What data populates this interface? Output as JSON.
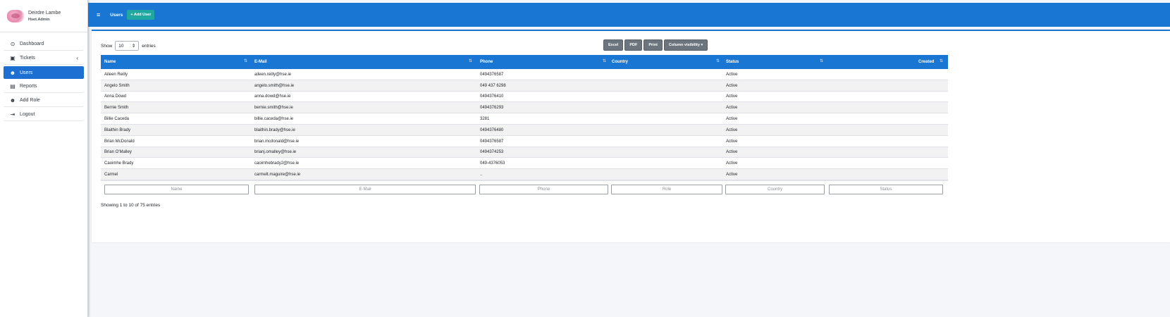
{
  "user": {
    "name": "Deirdre Lambe",
    "role": "Hset.Admin"
  },
  "sidebar": {
    "items": [
      {
        "label": "Dashboard",
        "icon": "dashboard-icon",
        "glyph": "⊙"
      },
      {
        "label": "Tickets",
        "icon": "ticket-icon",
        "glyph": "▣"
      },
      {
        "label": "Users",
        "icon": "users-icon",
        "glyph": "☻"
      },
      {
        "label": "Reports",
        "icon": "report-icon",
        "glyph": "▤"
      },
      {
        "label": "Add Role",
        "icon": "users-icon",
        "glyph": "☻"
      },
      {
        "label": "Logout",
        "icon": "logout-icon",
        "glyph": "⇥"
      }
    ],
    "caret": "‹"
  },
  "topbar": {
    "menu_glyph": "≡",
    "title": "Users",
    "add_user": "+ Add User"
  },
  "table_controls": {
    "show_label": "Show",
    "page_length": "10",
    "entries_label": "entries",
    "buttons": [
      "Excel",
      "PDF",
      "Print",
      "Column visibility ▾"
    ]
  },
  "table": {
    "columns": [
      "Name",
      "E-Mail",
      "Phone",
      "Country",
      "Status",
      "Created"
    ],
    "rows": [
      [
        "Aileen Reilly",
        "aileen.reilly@hse.ie",
        "0494376587",
        "",
        "Active",
        ""
      ],
      [
        "Angelo Smith",
        "angelo.smith@hse.ie",
        "049 437 6298",
        "",
        "Active",
        ""
      ],
      [
        "Anna Dowd",
        "anna.dowd@hse.ie",
        "0494376410",
        "",
        "Active",
        ""
      ],
      [
        "Bernie Smith",
        "bernie.smith@hse.ie",
        "0494376293",
        "",
        "Active",
        ""
      ],
      [
        "Billie Caceda",
        "billie.caceda@hse.ie",
        "3281",
        "",
        "Active",
        ""
      ],
      [
        "Blaithin Brady",
        "blaithin.brady@hse.ie",
        "0494376480",
        "",
        "Active",
        ""
      ],
      [
        "Brian McDonald",
        "brian.mcdonald@hse.ie",
        "0494376587",
        "",
        "Active",
        ""
      ],
      [
        "Brian O'Malley",
        "brianj.omalley@hse.ie",
        "0494374253",
        "",
        "Active",
        ""
      ],
      [
        "Caoimhe Brady",
        "caoimhebrady2@hse.ie",
        "049-4376053",
        "",
        "Active",
        ""
      ],
      [
        "Carmel",
        "carmelt.maguire@hse.ie",
        "..",
        "",
        "Active",
        ""
      ]
    ],
    "filter_placeholders": [
      "Name",
      "E-Mail",
      "Phone",
      "Role",
      "Country",
      "Status"
    ]
  },
  "info": "Showing 1 to 10 of 75 entries",
  "colors": {
    "primary": "#1976d2",
    "accent": "#20a8a0",
    "button_gray": "#6c757d"
  }
}
